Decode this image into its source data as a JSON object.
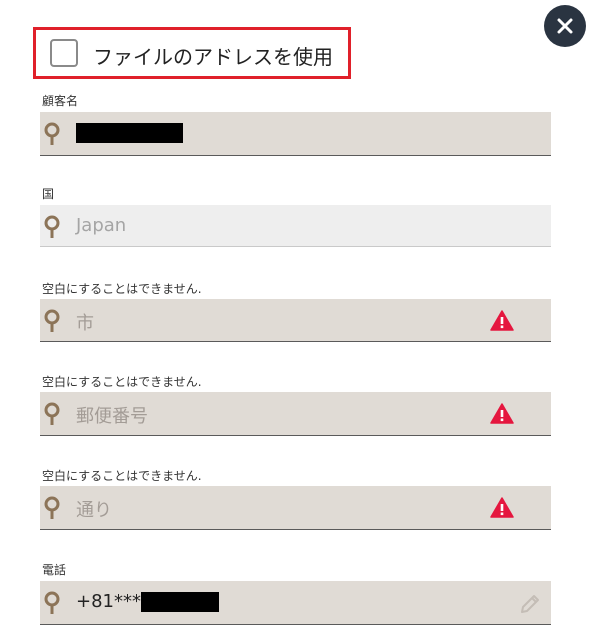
{
  "close_icon": "close-icon",
  "use_file_address": {
    "label": "ファイルのアドレスを使用",
    "checked": false
  },
  "fields": {
    "customer_name": {
      "label": "顧客名",
      "value": ""
    },
    "country": {
      "label": "国",
      "placeholder": "Japan"
    },
    "city": {
      "label": "空白にすることはできません.",
      "placeholder": "市"
    },
    "postal_code": {
      "label": "空白にすることはできません.",
      "placeholder": "郵便番号"
    },
    "street": {
      "label": "空白にすることはできません.",
      "placeholder": "通り"
    },
    "phone": {
      "label": "電話",
      "value": "+81***"
    }
  },
  "colors": {
    "field_bg": "#e0dbd5",
    "disabled_bg": "#eeeeee",
    "warning": "#e5173f",
    "highlight_border": "#e0202a",
    "close_bg": "#2a3441",
    "pin": "#8c7458"
  }
}
